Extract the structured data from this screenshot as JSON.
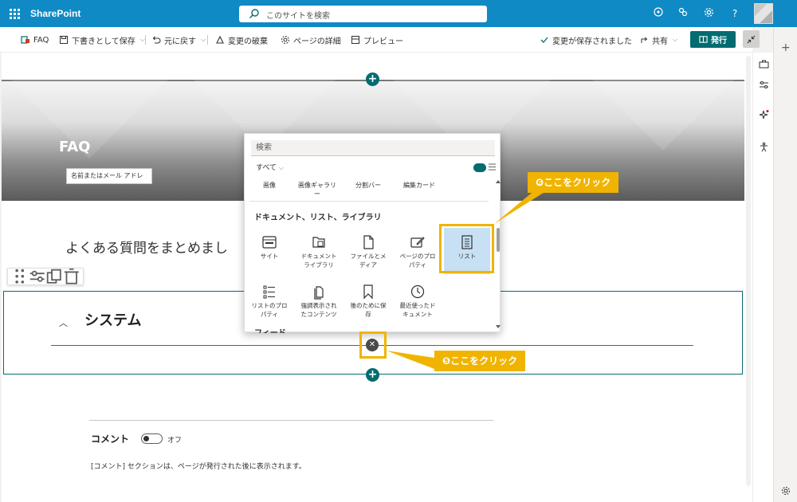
{
  "suitebar": {
    "brand": "SharePoint",
    "search_placeholder": "このサイトを検索",
    "help": "?",
    "bg_color": "#0f8ac4"
  },
  "commandbar": {
    "faq": "FAQ",
    "save_draft": "下書きとして保存",
    "undo": "元に戻す",
    "discard": "変更の破棄",
    "page_details": "ページの詳細",
    "preview": "プレビュー",
    "saved_status": "変更が保存されました",
    "share": "共有",
    "publish": "発行",
    "accent_color": "#036c70"
  },
  "hero": {
    "title": "FAQ",
    "author_placeholder": "名前またはメール アドレ"
  },
  "canvas": {
    "intro_text": "よくある質問をまとめまし",
    "section_title": "システム"
  },
  "comments": {
    "label": "コメント",
    "toggle_label": "オフ",
    "note": "[コメント] セクションは、ページが発行された後に表示されます。"
  },
  "toolbox": {
    "search_placeholder": "検索",
    "filter": "すべて",
    "top_row": [
      {
        "label": "画像"
      },
      {
        "label": "画像ギャラリ\nー"
      },
      {
        "label": "分割バー"
      },
      {
        "label": "編集カード"
      }
    ],
    "heading": "ドキュメント、リスト、ライブラリ",
    "items": [
      {
        "label": "サイト",
        "icon": "site-icon"
      },
      {
        "label": "ドキュメント\nライブラリ",
        "icon": "document-library-icon"
      },
      {
        "label": "ファイルとメ\nディア",
        "icon": "file-icon"
      },
      {
        "label": "ページのプロ\nパティ",
        "icon": "page-properties-icon"
      },
      {
        "label": "リスト",
        "icon": "list-icon"
      },
      {
        "label": "リストのプロ\nパティ",
        "icon": "list-properties-icon"
      },
      {
        "label": "強調表示され\nたコンテンツ",
        "icon": "highlighted-content-icon"
      },
      {
        "label": "後のために保\n存",
        "icon": "bookmark-icon"
      },
      {
        "label": "最近使ったド\nキュメント",
        "icon": "clock-icon"
      }
    ],
    "feed_heading": "フィード"
  },
  "annotations": {
    "callout_6": "❻ここをクリック",
    "callout_5": "❺ここをクリック",
    "highlight_color": "#f0b400"
  }
}
